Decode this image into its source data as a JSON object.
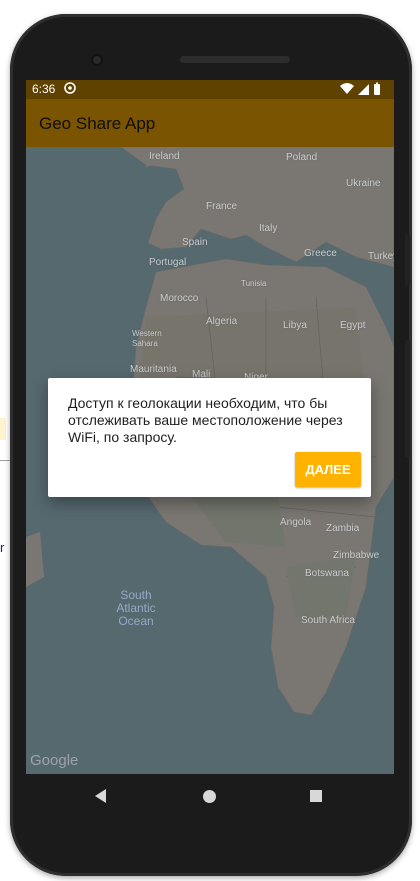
{
  "status_bar": {
    "time": "6:36"
  },
  "app": {
    "title": "Geo Share App"
  },
  "map": {
    "labels": {
      "ireland": "Ireland",
      "poland": "Poland",
      "ukraine": "Ukraine",
      "france": "France",
      "italy": "Italy",
      "spain": "Spain",
      "portugal": "Portugal",
      "greece": "Greece",
      "turkey": "Turkey",
      "tunisia": "Tunisia",
      "morocco": "Morocco",
      "algeria": "Algeria",
      "libya": "Libya",
      "egypt": "Egypt",
      "western_sahara": "Western Sahara",
      "mauritania": "Mauritania",
      "mali": "Mali",
      "niger": "Niger",
      "angola": "Angola",
      "zambia": "Zambia",
      "zimbabwe": "Zimbabwe",
      "botswana": "Botswana",
      "south_africa": "South Africa"
    },
    "ocean_label": [
      "South",
      "Atlantic",
      "Ocean"
    ],
    "attribution": "Google"
  },
  "dialog": {
    "message": "Доступ к геолокации необходим, что бы отслеживать ваше местоположение через WiFi, по запросу.",
    "button_label": "ДАЛЕЕ"
  },
  "page_edge": {
    "partial_char": "r"
  }
}
